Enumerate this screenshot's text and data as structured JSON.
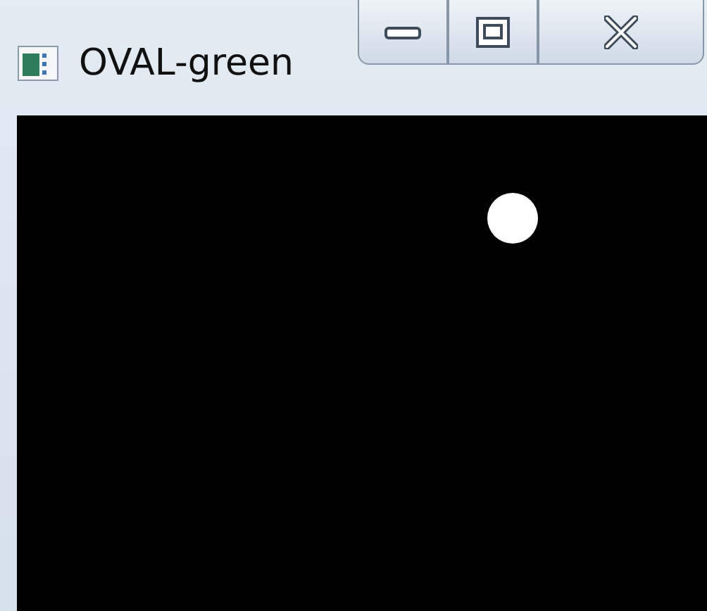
{
  "window": {
    "title": "OVAL-green"
  }
}
